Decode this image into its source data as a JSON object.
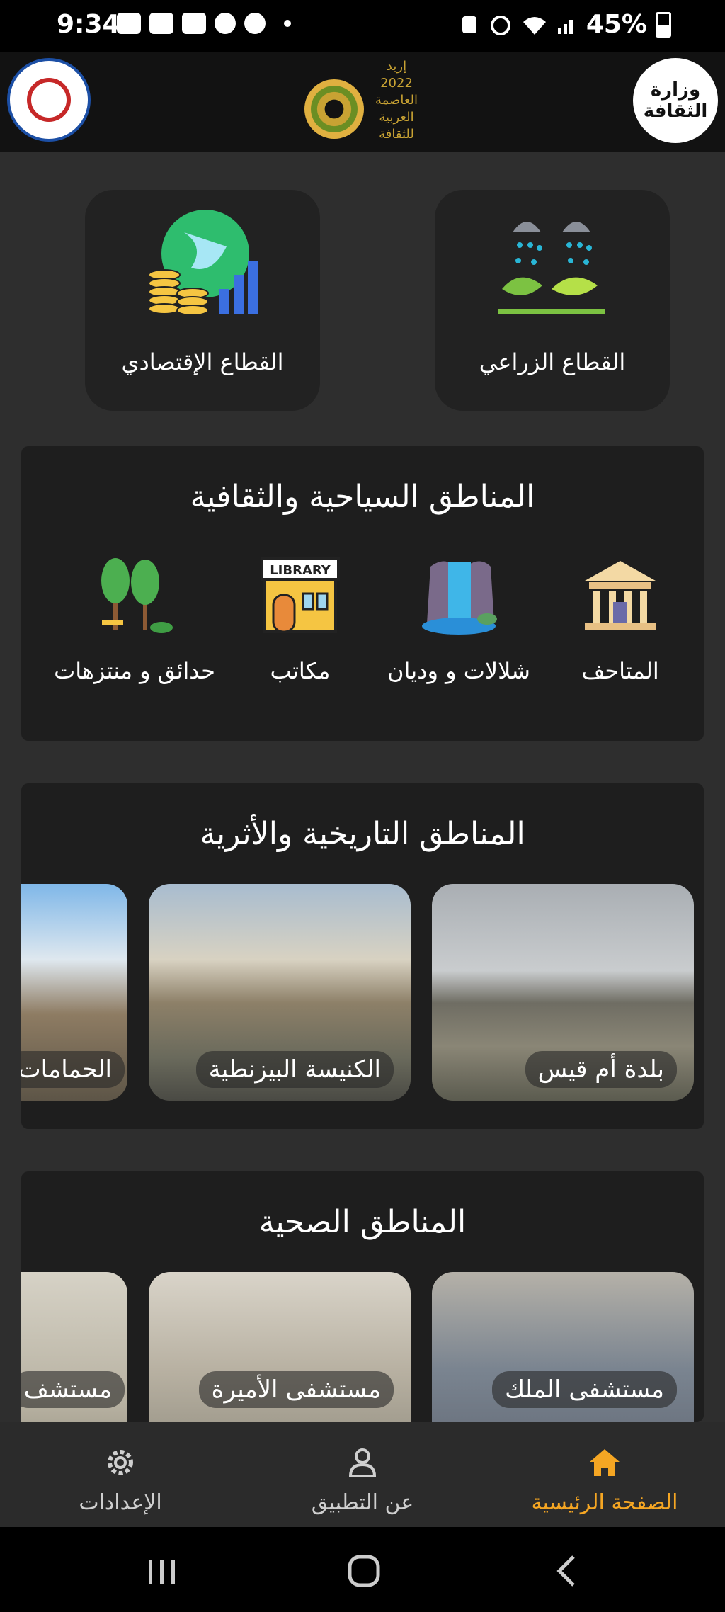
{
  "status_bar": {
    "time": "9:34",
    "battery": "45%",
    "notification_icons": [
      "message-icon",
      "youtube-icon",
      "youtube-icon",
      "instagram-icon",
      "snapchat-icon"
    ]
  },
  "header": {
    "left_logo": "university-logo",
    "center_logo_text": [
      "إربد",
      "2022",
      "العاصمة",
      "العربية",
      "للثقافة"
    ],
    "right_logo_text": [
      "وزارة",
      "الثقافة"
    ]
  },
  "sectors": [
    {
      "label": "القطاع الزراعي",
      "icon": "agriculture-icon"
    },
    {
      "label": "القطاع الإقتصادي",
      "icon": "economy-icon"
    }
  ],
  "tourism": {
    "title": "المناطق السياحية والثقافية",
    "items": [
      {
        "label": "المتاحف",
        "icon": "museum-icon"
      },
      {
        "label": "شلالات و وديان",
        "icon": "waterfall-icon"
      },
      {
        "label": "مكاتب",
        "icon": "library-icon",
        "sign": "LIBRARY"
      },
      {
        "label": "حدائق و منتزهات",
        "icon": "park-icon"
      }
    ]
  },
  "historic": {
    "title": "المناطق التاريخية والأثرية",
    "items": [
      {
        "label": "بلدة أم قيس"
      },
      {
        "label": "الكنيسة البيزنطية"
      },
      {
        "label": "الحمامات"
      }
    ]
  },
  "health": {
    "title": "المناطق الصحية",
    "items": [
      {
        "label": "مستشفى الملك"
      },
      {
        "label": "مستشفى الأميرة"
      },
      {
        "label": "مستشف"
      }
    ]
  },
  "bottom_nav": [
    {
      "label": "الصفحة الرئيسية",
      "icon": "home-icon",
      "active": true
    },
    {
      "label": "عن التطبيق",
      "icon": "person-icon",
      "active": false
    },
    {
      "label": "الإعدادات",
      "icon": "gear-icon",
      "active": false
    }
  ],
  "colors": {
    "accent": "#f5a623",
    "background": "#2e2e2e",
    "card": "#1e1e1e"
  }
}
